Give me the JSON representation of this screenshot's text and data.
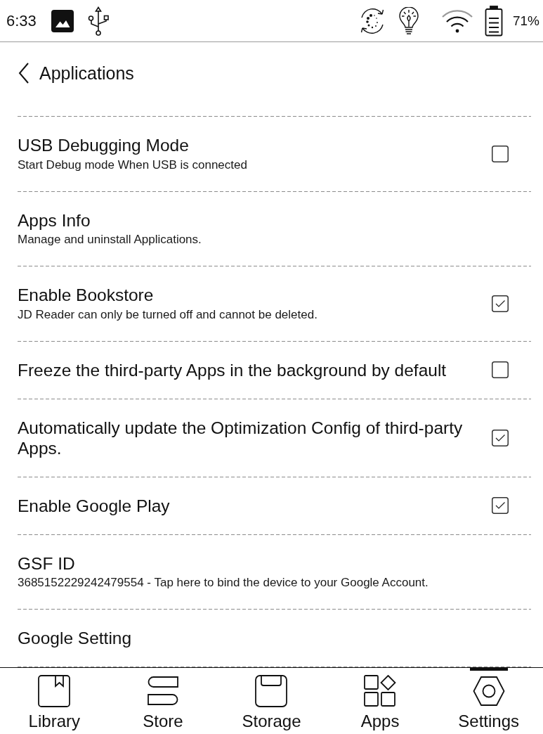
{
  "status_bar": {
    "time": "6:33",
    "battery": "71%"
  },
  "header": {
    "title": "Applications"
  },
  "settings": [
    {
      "kind": "checkbox",
      "title": "USB Debugging Mode",
      "subtitle": "Start Debug mode When USB is connected",
      "checked": false
    },
    {
      "kind": "plain",
      "title": "Apps Info",
      "subtitle": "Manage and uninstall Applications."
    },
    {
      "kind": "checkbox",
      "title": "Enable Bookstore",
      "subtitle": "JD Reader can only be turned off and cannot be deleted.",
      "checked": true
    },
    {
      "kind": "checkbox",
      "title": "Freeze the third-party Apps in the background by default",
      "checked": false
    },
    {
      "kind": "checkbox",
      "title": "Automatically update the Optimization Config of third-party Apps.",
      "checked": true
    },
    {
      "kind": "checkbox",
      "title": "Enable Google Play",
      "checked": true
    },
    {
      "kind": "plain",
      "title": "GSF ID",
      "subtitle": "3685152229242479554 - Tap here to bind the device to your Google Account."
    },
    {
      "kind": "plain",
      "title": "Google Setting"
    }
  ],
  "nav": [
    {
      "label": "Library",
      "selected": false
    },
    {
      "label": "Store",
      "selected": false
    },
    {
      "label": "Storage",
      "selected": false
    },
    {
      "label": "Apps",
      "selected": false
    },
    {
      "label": "Settings",
      "selected": true
    }
  ]
}
